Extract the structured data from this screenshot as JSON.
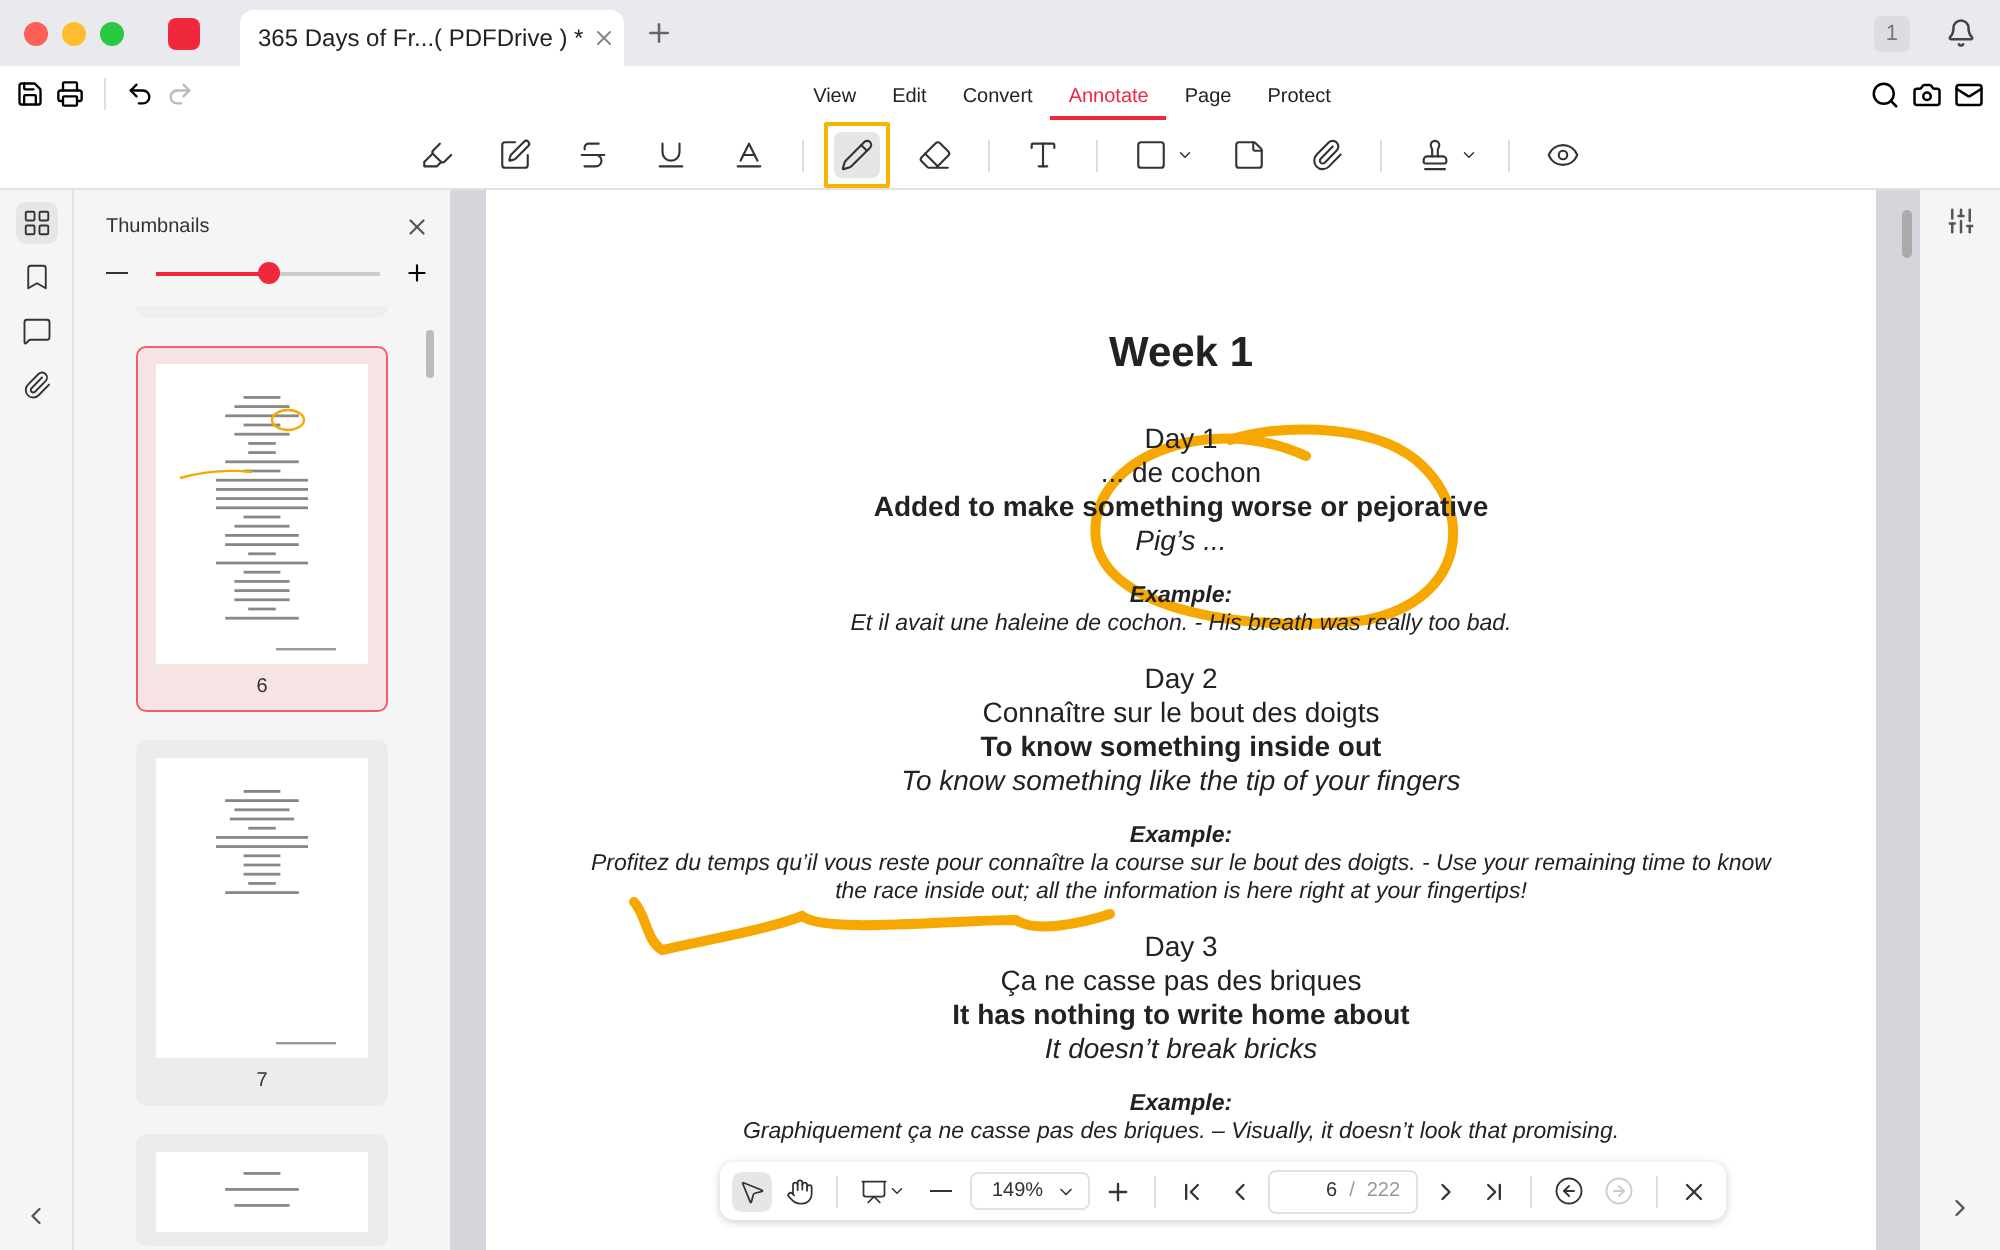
{
  "tab": {
    "title": "365 Days of Fr...( PDFDrive ) *"
  },
  "notification_count": "1",
  "menu": [
    {
      "label": "View",
      "selected": false
    },
    {
      "label": "Edit",
      "selected": false
    },
    {
      "label": "Convert",
      "selected": false
    },
    {
      "label": "Annotate",
      "selected": true
    },
    {
      "label": "Page",
      "selected": false
    },
    {
      "label": "Protect",
      "selected": false
    }
  ],
  "tools": [
    {
      "kind": "highlighter",
      "selected": false
    },
    {
      "kind": "area",
      "selected": false
    },
    {
      "kind": "strikethrough",
      "selected": false
    },
    {
      "kind": "underline",
      "selected": false
    },
    {
      "kind": "squiggly",
      "selected": false
    },
    {
      "kind": "pencil",
      "selected": true
    },
    {
      "kind": "eraser",
      "selected": false
    },
    {
      "kind": "text",
      "selected": false
    },
    {
      "kind": "shape",
      "selected": false
    },
    {
      "kind": "note",
      "selected": false
    },
    {
      "kind": "attachment",
      "selected": false
    },
    {
      "kind": "stamp",
      "selected": false
    },
    {
      "kind": "preview",
      "selected": false
    }
  ],
  "left_rail": [
    {
      "kind": "thumbnails",
      "selected": true
    },
    {
      "kind": "bookmarks",
      "selected": false
    },
    {
      "kind": "comments",
      "selected": false
    },
    {
      "kind": "attachments",
      "selected": false
    }
  ],
  "sidebar": {
    "title": "Thumbnails",
    "zoom": {
      "level": 0.5
    },
    "thumbnails": [
      {
        "label": "6",
        "selected": true,
        "kind": "annotated"
      },
      {
        "label": "7",
        "selected": false,
        "kind": "short"
      },
      {
        "selected": false,
        "kind": "recap"
      }
    ]
  },
  "document": {
    "lines": [
      {
        "kind": "heading",
        "text": "Week 1"
      },
      {
        "kind": "day",
        "text": "Day 1"
      },
      {
        "kind": "french",
        "text": "... de cochon"
      },
      {
        "kind": "meaning",
        "text": "Added to make something worse or pejorative"
      },
      {
        "kind": "literal",
        "text": "Pig’s ..."
      },
      {
        "kind": "example_label",
        "text": "Example:"
      },
      {
        "kind": "example",
        "text": "Et il avait une haleine de cochon. - His breath was really too bad."
      },
      {
        "kind": "day",
        "text": "Day 2"
      },
      {
        "kind": "french",
        "text": "Connaître sur le bout des doigts"
      },
      {
        "kind": "meaning",
        "text": "To know something inside out"
      },
      {
        "kind": "literal",
        "text": "To know something like the tip of your fingers"
      },
      {
        "kind": "example_label",
        "text": "Example:"
      },
      {
        "kind": "example",
        "text": "Profitez du temps qu’il vous reste pour connaître la course sur le bout des doigts. - Use your remaining time to know the race inside out; all the information is here right at your fingertips!"
      },
      {
        "kind": "day",
        "text": "Day 3"
      },
      {
        "kind": "french",
        "text": "Ça ne casse pas des briques"
      },
      {
        "kind": "meaning",
        "text": "It has nothing to write home about"
      },
      {
        "kind": "literal",
        "text": "It doesn’t break bricks"
      },
      {
        "kind": "example_label",
        "text": "Example:"
      },
      {
        "kind": "example",
        "text": "Graphiquement ça ne casse pas des briques. – Visually, it doesn’t look that promising."
      }
    ]
  },
  "floating_bar": {
    "zoom": "149%",
    "page": "6",
    "separator": "/",
    "total": "222"
  }
}
